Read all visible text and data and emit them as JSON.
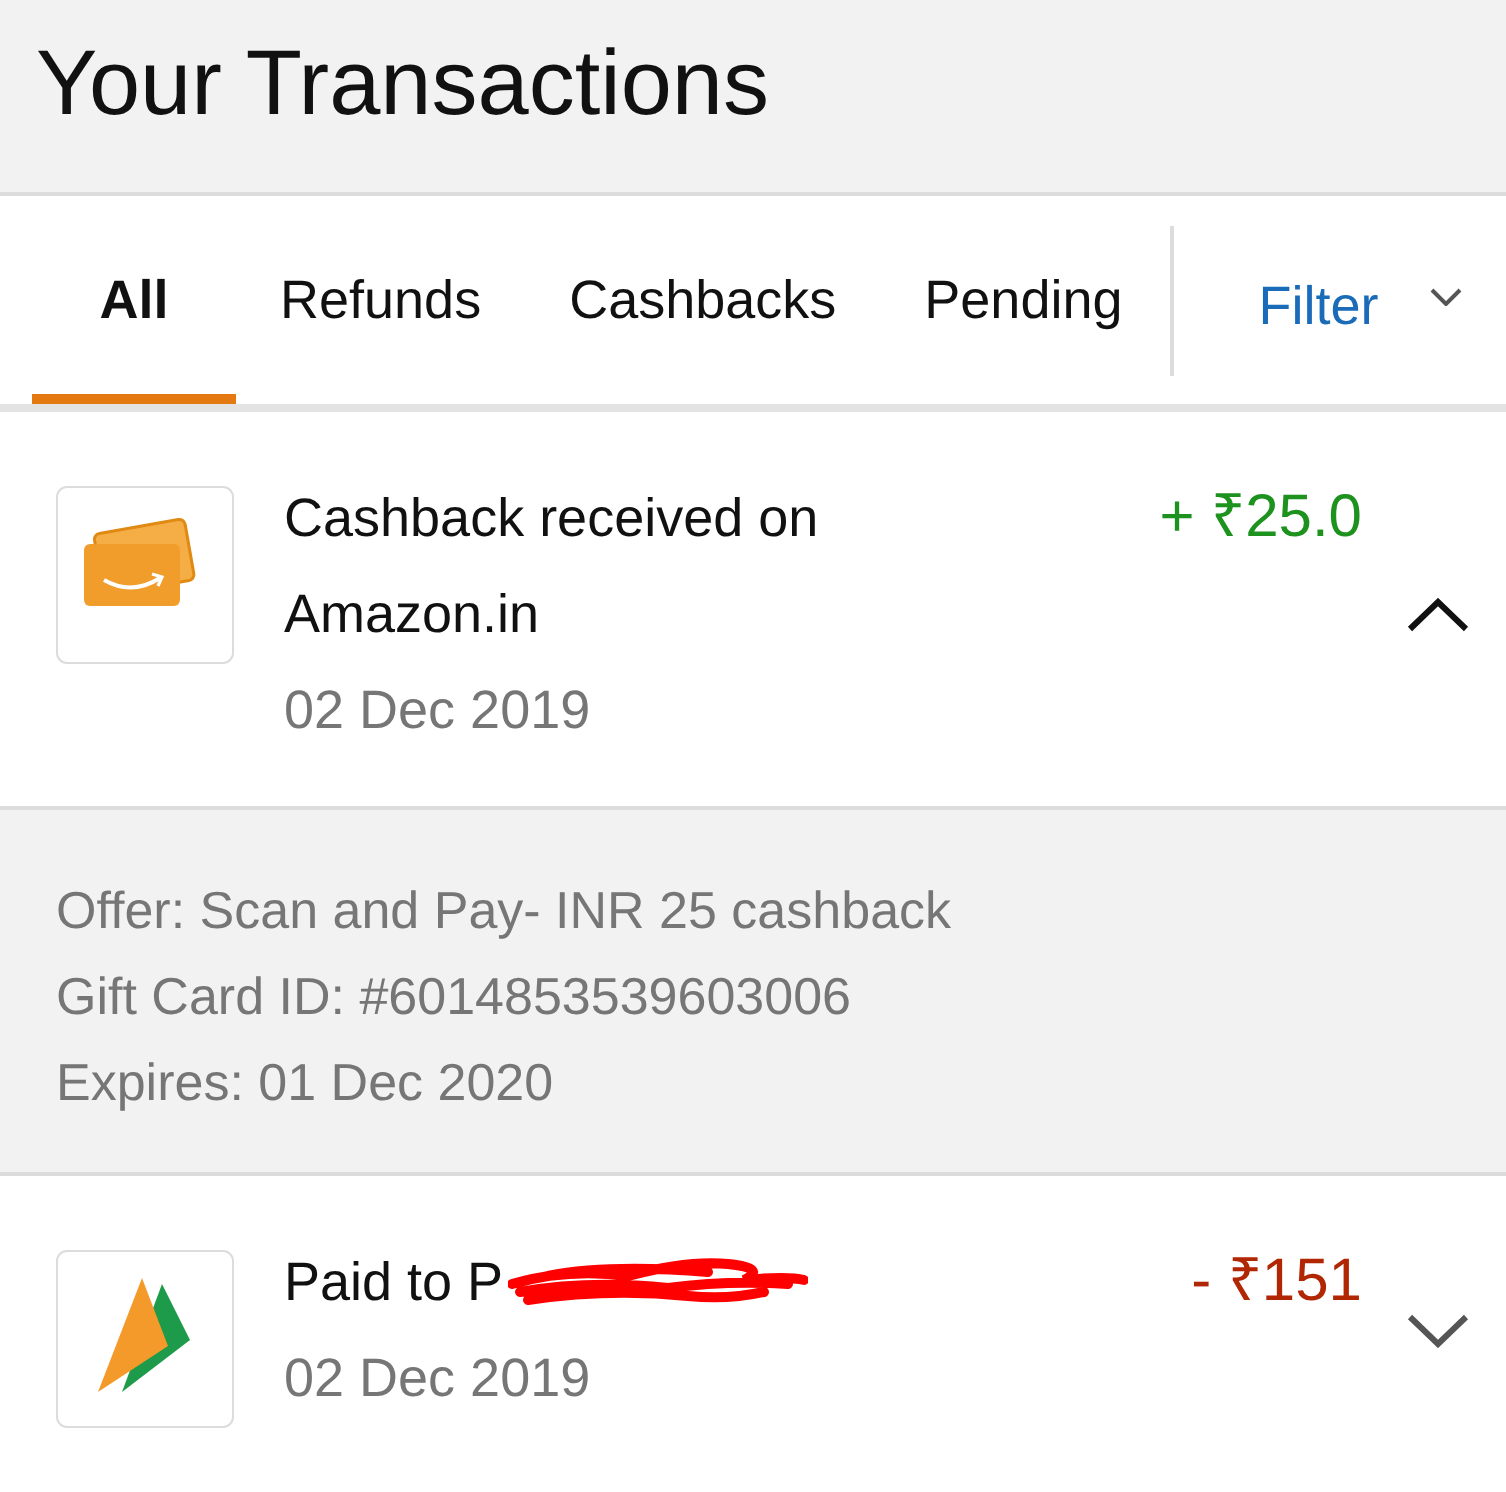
{
  "header": {
    "title": "Your Transactions"
  },
  "tabs": [
    {
      "label": "All",
      "selected": true
    },
    {
      "label": "Refunds",
      "selected": false
    },
    {
      "label": "Cashbacks",
      "selected": false
    },
    {
      "label": "Pending",
      "selected": false
    }
  ],
  "filter": {
    "label": "Filter"
  },
  "transactions": [
    {
      "kind": "gift_card",
      "title": "Cashback received on Amazon.in",
      "amount": "+ ₹25.0",
      "color": "#1e921e",
      "date": "02 Dec 2019",
      "expanded": true,
      "details": [
        "Offer: Scan and Pay- INR 25 cashback",
        "Gift Card ID: #6014853539603006",
        "Expires: 01 Dec 2020"
      ]
    },
    {
      "kind": "upi",
      "title": "Paid to P",
      "redacted": true,
      "amount": "- ₹151",
      "color": "#b12704",
      "date": "02 Dec 2019",
      "expanded": false
    }
  ]
}
